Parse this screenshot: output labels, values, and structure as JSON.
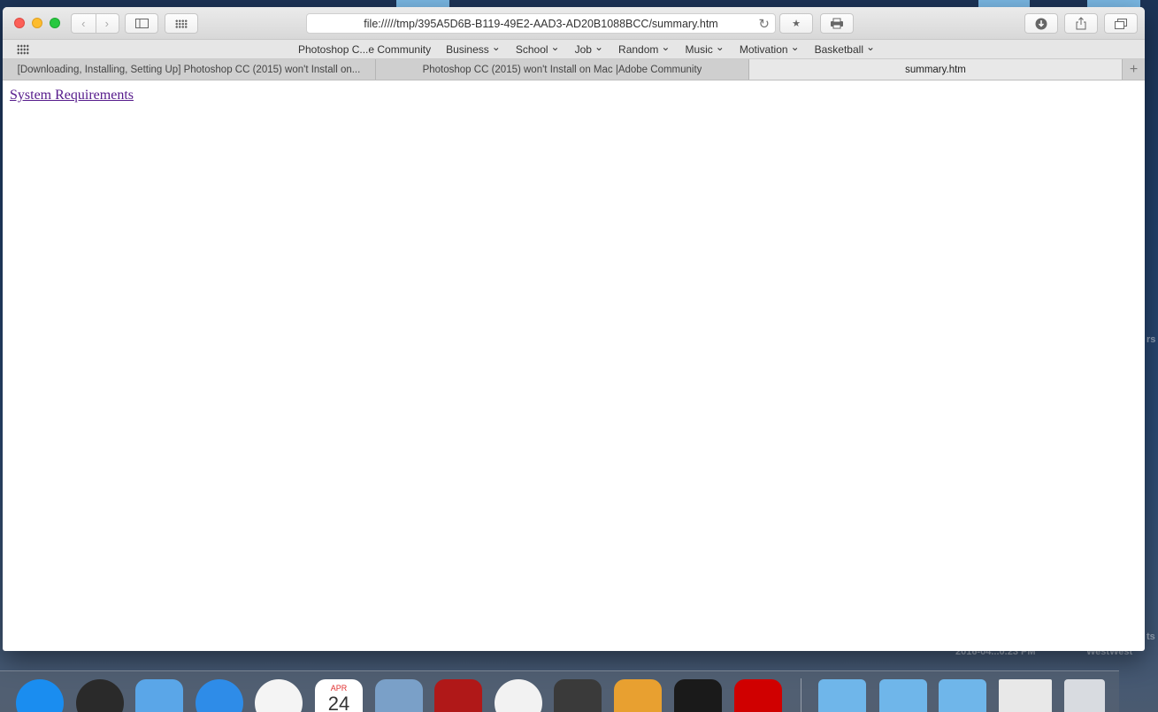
{
  "desktop": {
    "corner_text_1": "rs",
    "corner_text_2": "ts",
    "clock_text": "2016-04...0.23 PM",
    "location_text": "WestWest"
  },
  "browser": {
    "address_url": "file://///tmp/395A5D6B-B119-49E2-AAD3-AD20B1088BCC/summary.htm",
    "favorites": [
      {
        "label": "Photoshop C...e Community",
        "has_menu": false
      },
      {
        "label": "Business",
        "has_menu": true
      },
      {
        "label": "School",
        "has_menu": true
      },
      {
        "label": "Job",
        "has_menu": true
      },
      {
        "label": "Random",
        "has_menu": true
      },
      {
        "label": "Music",
        "has_menu": true
      },
      {
        "label": "Motivation",
        "has_menu": true
      },
      {
        "label": "Basketball",
        "has_menu": true
      }
    ],
    "tabs": [
      {
        "title": "[Downloading, Installing, Setting Up] Photoshop CC (2015) won't Install on...",
        "active": false
      },
      {
        "title": "Photoshop CC (2015) won't Install on Mac |Adobe Community",
        "active": false
      },
      {
        "title": "summary.htm",
        "active": true
      }
    ]
  },
  "page": {
    "link_text": "System Requirements"
  },
  "dock": {
    "calendar_month": "APR",
    "calendar_day": "24",
    "apps": [
      {
        "name": "app-store",
        "color": "#1a8df0"
      },
      {
        "name": "dashboard",
        "color": "#2a2a2a"
      },
      {
        "name": "mail",
        "color": "#5aa6e8"
      },
      {
        "name": "safari",
        "color": "#2e8ce8"
      },
      {
        "name": "itunes",
        "color": "#f4f4f4"
      },
      {
        "name": "calendar",
        "color": "#ffffff"
      },
      {
        "name": "preview",
        "color": "#7aa0c8"
      },
      {
        "name": "photo-booth",
        "color": "#b01818"
      },
      {
        "name": "photos",
        "color": "#f2f2f2"
      },
      {
        "name": "imovie",
        "color": "#3a3a3a"
      },
      {
        "name": "garageband",
        "color": "#e8a030"
      },
      {
        "name": "activity-monitor",
        "color": "#1a1a1a"
      },
      {
        "name": "adobe",
        "color": "#d00000"
      }
    ]
  }
}
